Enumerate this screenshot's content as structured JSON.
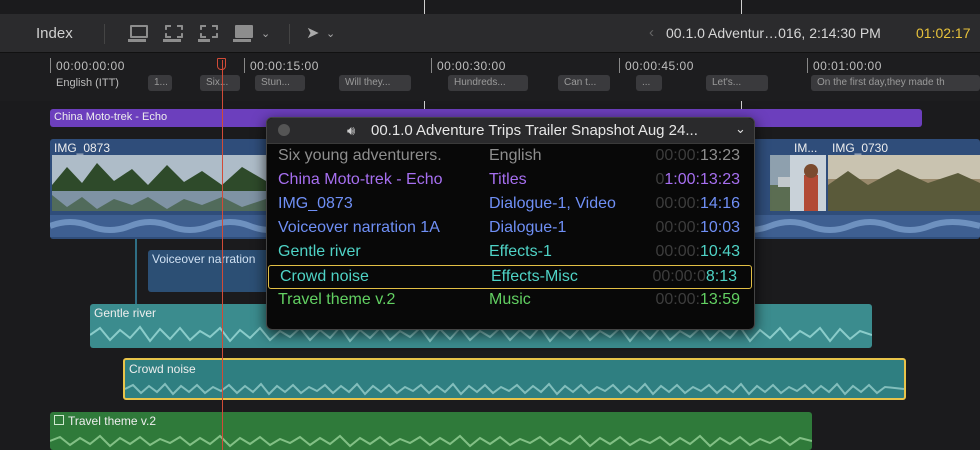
{
  "toolbar": {
    "index_label": "Index",
    "project_info": "00.1.0 Adventur…016, 2:14:30 PM",
    "timecode": "01:02:17"
  },
  "ruler": {
    "labels": [
      "00:00:00:00",
      "00:00:15:00",
      "00:00:30:00",
      "00:00:45:00",
      "00:01:00:00"
    ],
    "caption_language": "English (ITT)",
    "captions": [
      "1...",
      "Six...",
      "Stun...",
      "Will they...",
      "Hundreds...",
      "Can t...",
      "...",
      "Let's...",
      "On the first day,they made th"
    ]
  },
  "clips": {
    "title": "China Moto-trek - Echo",
    "video_primary": "IMG_0873",
    "video_short": "IM...",
    "video_last": "IMG_0730",
    "voiceover": "Voiceover narration",
    "gentle": "Gentle river",
    "crowd": "Crowd noise",
    "music": "Travel theme v.2"
  },
  "popup": {
    "title": "00.1.0 Adventure Trips Trailer Snapshot Aug 24...",
    "rows": [
      {
        "name": "Six young adventurers.",
        "role": "English",
        "tc_dim": "00:00:",
        "tc_bright": "13:23",
        "color": "#8e8e8e"
      },
      {
        "name": "China Moto-trek - Echo",
        "role": "Titles",
        "tc_dim": "0",
        "tc_bright": "1:00:13:23",
        "color": "#a66ff0"
      },
      {
        "name": "IMG_0873",
        "role": "Dialogue-1, Video",
        "tc_dim": "00:00:",
        "tc_bright": "14:16",
        "color": "#6f8ff5"
      },
      {
        "name": "Voiceover narration 1A",
        "role": "Dialogue-1",
        "tc_dim": "00:00:",
        "tc_bright": "10:03",
        "color": "#6f8ff5"
      },
      {
        "name": "Gentle river",
        "role": "Effects-1",
        "tc_dim": "00:00:",
        "tc_bright": "10:43",
        "color": "#4fd3c6"
      },
      {
        "name": "Crowd noise",
        "role": "Effects-Misc",
        "tc_dim": "00:00:0",
        "tc_bright": "8:13",
        "color": "#4fd3c6"
      },
      {
        "name": "Travel theme v.2",
        "role": "Music",
        "tc_dim": "00:00:",
        "tc_bright": "13:59",
        "color": "#62d062"
      }
    ]
  },
  "colors": {
    "timecode": "#e7c23b",
    "playhead": "#d24b37",
    "selection": "#e2bf45",
    "title_clip": "#6c3fbd",
    "video_clip": "#2f4d7a",
    "effects_clip": "#3b8c8e",
    "music_clip": "#2f7a3a"
  },
  "icons": [
    "insert-clip-icon",
    "connect-clip-icon",
    "append-clip-icon",
    "overwrite-clip-icon",
    "select-tool-icon",
    "speaker-icon",
    "chevron-down-icon"
  ]
}
